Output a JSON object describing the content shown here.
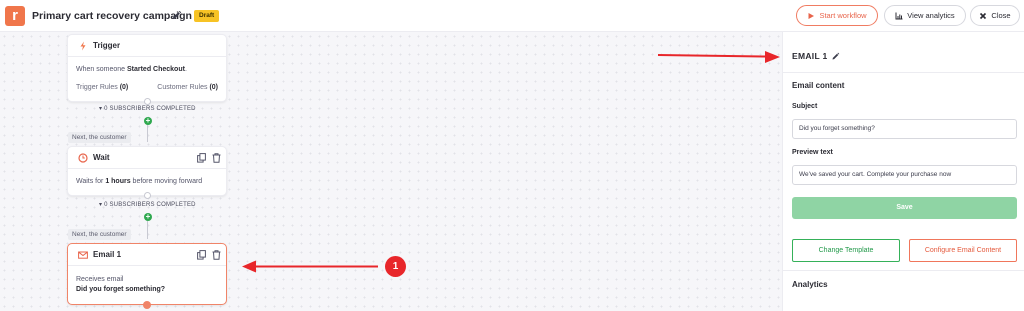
{
  "header": {
    "logo_letter": "r",
    "campaign_title": "Primary cart recovery campaign",
    "status_badge": "Draft",
    "start_label": "Start workflow",
    "analytics_label": "View analytics",
    "close_label": "Close"
  },
  "canvas": {
    "trigger": {
      "title": "Trigger",
      "text_prefix": "When someone ",
      "text_event": "Started Checkout",
      "text_suffix": ".",
      "trigger_rules_label": "Trigger Rules ",
      "trigger_rules_count": "(0)",
      "customer_rules_label": "Customer Rules ",
      "customer_rules_count": "(0)",
      "subscribers": "▾ 0 SUBSCRIBERS COMPLETED"
    },
    "next_label_1": "Next, the customer",
    "wait": {
      "title": "Wait",
      "text_prefix": "Waits for ",
      "text_duration": "1 hours",
      "text_suffix": " before moving forward",
      "subscribers": "▾ 0 SUBSCRIBERS COMPLETED"
    },
    "next_label_2": "Next, the customer",
    "email": {
      "title": "Email 1",
      "line1": "Receives email",
      "subject": "Did you forget something?"
    },
    "annotation_number": "1"
  },
  "panel": {
    "title": "EMAIL 1",
    "section_content": "Email content",
    "subject_label": "Subject",
    "subject_value": "Did you forget something?",
    "preview_label": "Preview text",
    "preview_value": "We've saved your cart. Complete your purchase now",
    "save_label": "Save",
    "change_template_label": "Change Template",
    "configure_label": "Configure Email Content",
    "section_analytics": "Analytics"
  },
  "colors": {
    "brand": "#f0764b",
    "draft": "#f7c325",
    "save_disabled": "#8fd4a4",
    "annotation_red": "#e8262a"
  },
  "icons": [
    "pencil-icon",
    "play-icon",
    "bar-chart-icon",
    "close-icon",
    "lightning-icon",
    "clock-icon",
    "envelope-icon",
    "copy-icon",
    "trash-icon",
    "plus-icon"
  ]
}
